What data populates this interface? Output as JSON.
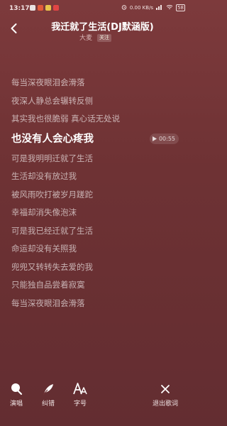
{
  "status": {
    "time": "13:17",
    "network": "0.00 KB/s",
    "battery": "58"
  },
  "header": {
    "title": "我迁就了生活(DJ默涵版)",
    "artist": "大麦",
    "follow_label": "关注"
  },
  "lyrics": {
    "lines": [
      "每当深夜眼泪会滑落",
      "夜深人静总会辗转反侧",
      "其实我也很脆弱 真心话无处说",
      "也没有人会心疼我",
      "可是我明明迁就了生活",
      "生活却没有放过我",
      "被风雨吹打被岁月蹉跎",
      "幸福却消失像泡沫",
      "可是我已经迁就了生活",
      "命运却没有关照我",
      "兜兜又转转失去爱的我",
      "只能独自品尝着寂寞",
      "每当深夜眼泪会滑落"
    ],
    "active_index": 3,
    "active_timestamp": "00:55"
  },
  "toolbar": {
    "sing_label": "演唱",
    "correct_label": "纠错",
    "font_label": "字号",
    "exit_label": "退出歌词"
  },
  "colors": {
    "background_top": "#7d3a3c",
    "background_bottom": "#632d31"
  }
}
